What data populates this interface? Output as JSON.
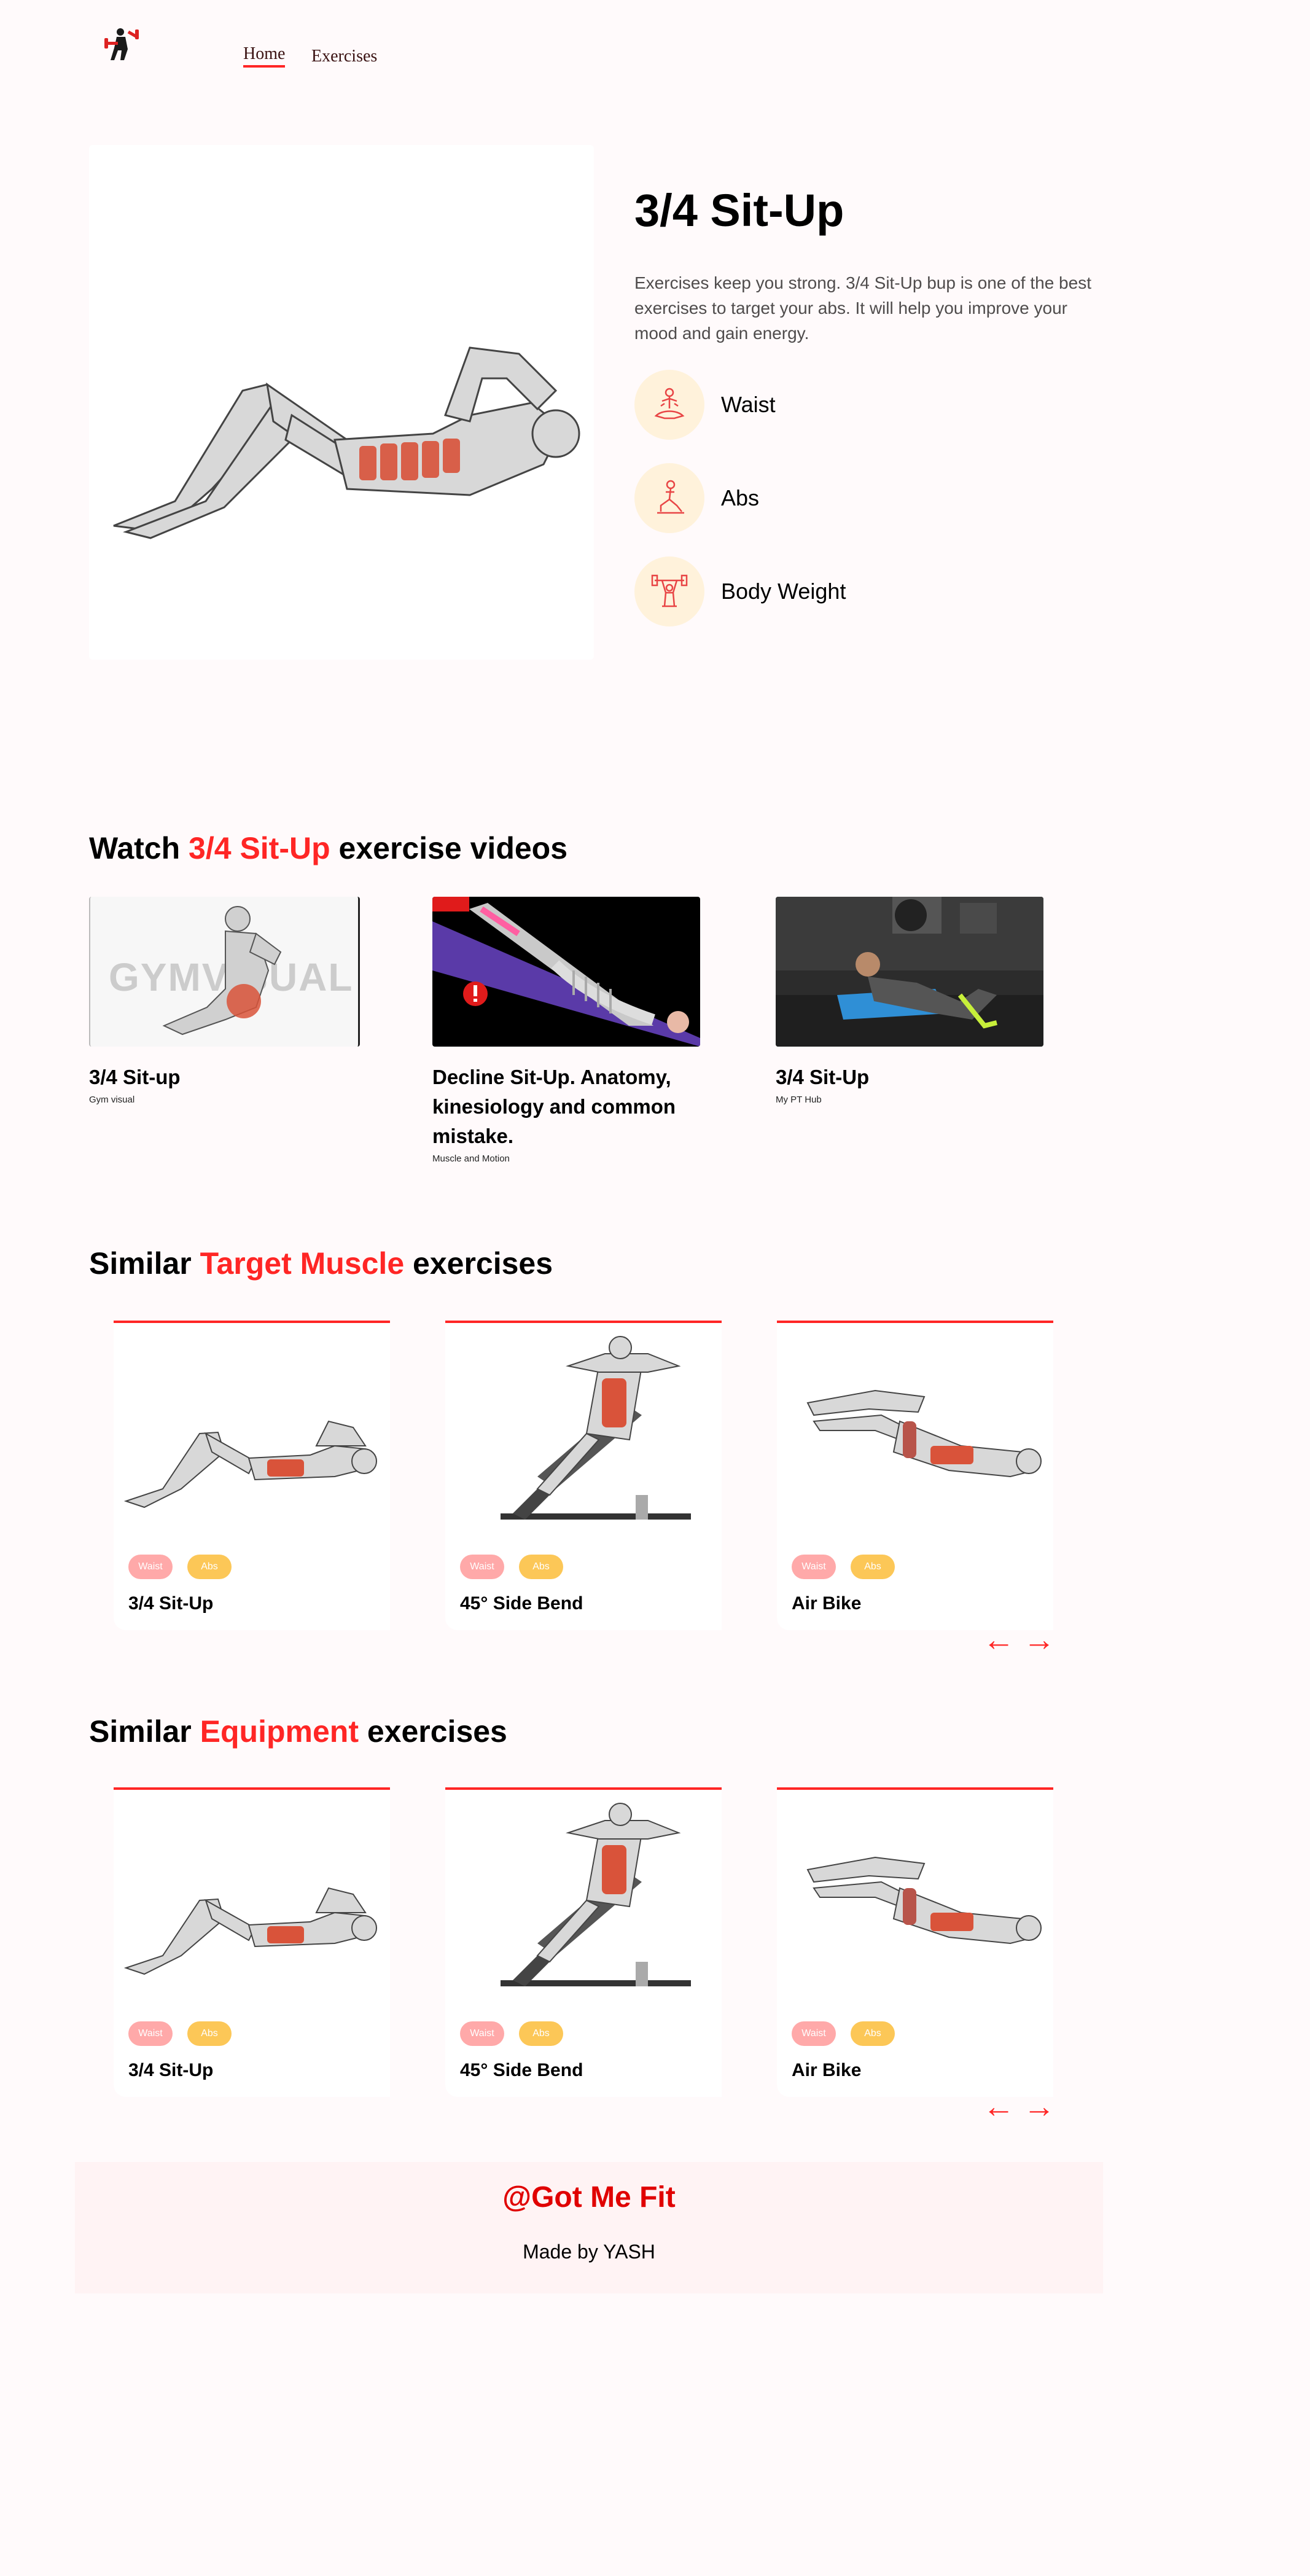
{
  "nav": {
    "home": "Home",
    "exercises": "Exercises"
  },
  "hero": {
    "title": "3/4 Sit-Up",
    "description": "Exercises keep you strong. 3/4 Sit-Up bup is one of the best exercises to target your abs. It will help you improve your mood and gain energy.",
    "details": [
      {
        "label": "Waist",
        "icon": "meditation-icon"
      },
      {
        "label": "Abs",
        "icon": "lunge-figure-icon"
      },
      {
        "label": "Body Weight",
        "icon": "weightlifter-icon"
      }
    ]
  },
  "videos": {
    "title_pre": "Watch ",
    "title_highlight": "3/4 Sit-Up",
    "title_post": " exercise videos",
    "items": [
      {
        "title": "3/4 Sit-up",
        "channel": "Gym visual",
        "watermark": "GYMVISUAL"
      },
      {
        "title": "Decline Sit-Up. Anatomy, kinesiology and common mistake.",
        "channel": "Muscle and Motion"
      },
      {
        "title": "3/4 Sit-Up",
        "channel": "My PT Hub"
      }
    ]
  },
  "similar_target": {
    "title_pre": "Similar ",
    "title_highlight": "Target Muscle",
    "title_post": " exercises",
    "cards": [
      {
        "name": "3/4 Sit-Up",
        "tags": [
          "Waist",
          "Abs"
        ]
      },
      {
        "name": "45° Side Bend",
        "tags": [
          "Waist",
          "Abs"
        ]
      },
      {
        "name": "Air Bike",
        "tags": [
          "Waist",
          "Abs"
        ]
      }
    ]
  },
  "similar_equipment": {
    "title_pre": "Similar ",
    "title_highlight": "Equipment",
    "title_post": " exercises",
    "cards": [
      {
        "name": "3/4 Sit-Up",
        "tags": [
          "Waist",
          "Abs"
        ]
      },
      {
        "name": "45° Side Bend",
        "tags": [
          "Waist",
          "Abs"
        ]
      },
      {
        "name": "Air Bike",
        "tags": [
          "Waist",
          "Abs"
        ]
      }
    ]
  },
  "arrows": {
    "left": "←",
    "right": "→"
  },
  "footer": {
    "brand": "@Got Me Fit",
    "credit": "Made by YASH"
  },
  "colors": {
    "accent": "#ff2625",
    "background": "#fffafb",
    "pill_waist": "#ffa9a9",
    "pill_abs": "#fcc757",
    "detail_circle": "#fff2db"
  }
}
